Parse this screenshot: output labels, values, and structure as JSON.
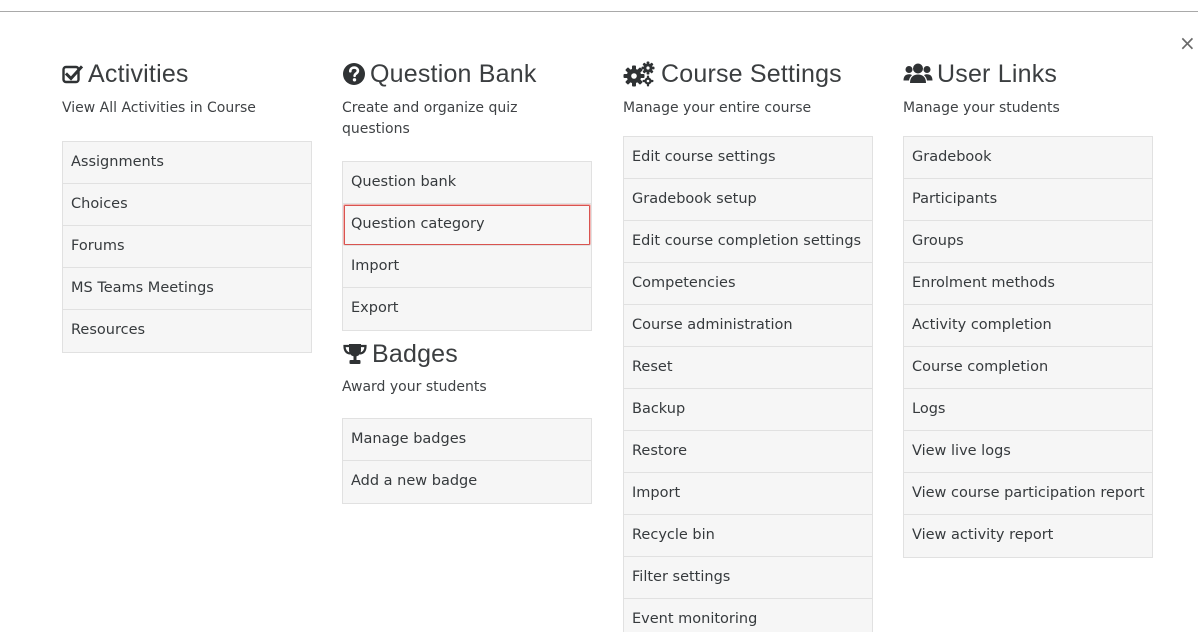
{
  "close_label": "×",
  "columns": [
    {
      "sections": [
        {
          "icon": "checkbox-icon",
          "title": "Activities",
          "description": "View All Activities in Course",
          "items": [
            "Assignments",
            "Choices",
            "Forums",
            "MS Teams Meetings",
            "Resources"
          ]
        }
      ]
    },
    {
      "sections": [
        {
          "icon": "question-circle-icon",
          "title": "Question Bank",
          "description": "Create and organize quiz questions",
          "items": [
            "Question bank",
            "Question category",
            "Import",
            "Export"
          ],
          "focused_item": "Question category"
        },
        {
          "icon": "trophy-icon",
          "title": "Badges",
          "description": "Award your students",
          "items": [
            "Manage badges",
            "Add a new badge"
          ]
        }
      ]
    },
    {
      "sections": [
        {
          "icon": "gears-icon",
          "title": "Course Settings",
          "description": "Manage your entire course",
          "items": [
            "Edit course settings",
            "Gradebook setup",
            "Edit course completion settings",
            "Competencies",
            "Course administration",
            "Reset",
            "Backup",
            "Restore",
            "Import",
            "Recycle bin",
            "Filter settings",
            "Event monitoring"
          ]
        }
      ]
    },
    {
      "sections": [
        {
          "icon": "users-icon",
          "title": "User Links",
          "description": "Manage your students",
          "items": [
            "Gradebook",
            "Participants",
            "Groups",
            "Enrolment methods",
            "Activity completion",
            "Course completion",
            "Logs",
            "View live logs",
            "View course participation report",
            "View activity report"
          ]
        }
      ]
    }
  ]
}
